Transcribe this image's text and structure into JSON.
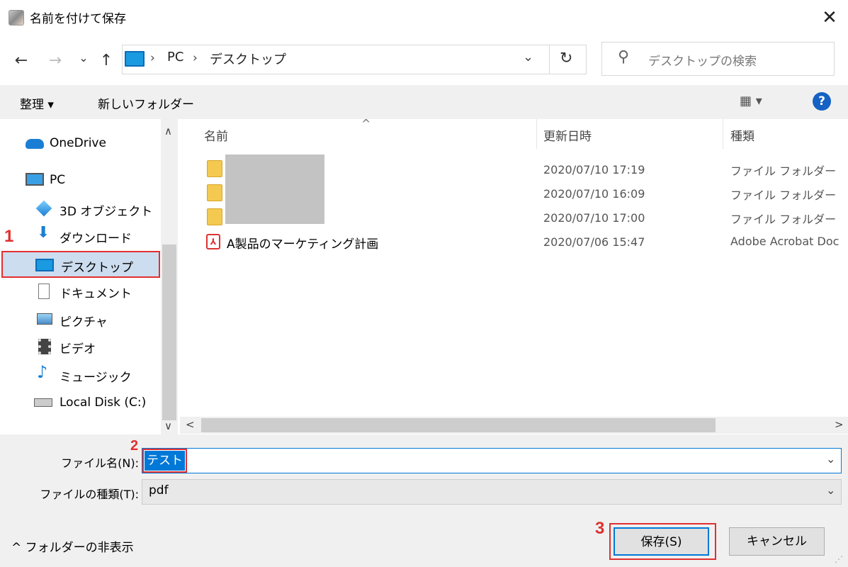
{
  "window": {
    "title": "名前を付けて保存",
    "close": "✕"
  },
  "address": {
    "back": "←",
    "forward": "→",
    "recent": "⌄",
    "up": "↑",
    "sep": "›",
    "crumbs": [
      "PC",
      "デスクトップ"
    ],
    "dropdown": "⌄",
    "refresh": "↻",
    "search_placeholder": "デスクトップの検索"
  },
  "toolbar": {
    "organize": "整理 ▾",
    "new_folder": "新しいフォルダー",
    "view": "▦ ▾",
    "help": "?"
  },
  "nav": {
    "items": [
      {
        "label": "OneDrive"
      },
      {
        "label": "PC"
      },
      {
        "label": "3D オブジェクト"
      },
      {
        "label": "ダウンロード"
      },
      {
        "label": "デスクトップ"
      },
      {
        "label": "ドキュメント"
      },
      {
        "label": "ピクチャ"
      },
      {
        "label": "ビデオ"
      },
      {
        "label": "ミュージック"
      },
      {
        "label": "Local Disk (C:)"
      }
    ],
    "scroll_up": "∧",
    "scroll_down": "∨"
  },
  "filelist": {
    "columns": [
      "名前",
      "更新日時",
      "種類"
    ],
    "sort_caret": "^",
    "rows": [
      {
        "name": "",
        "date": "2020/07/10 17:19",
        "type": "ファイル フォルダー"
      },
      {
        "name": "",
        "date": "2020/07/10 16:09",
        "type": "ファイル フォルダー"
      },
      {
        "name": "",
        "date": "2020/07/10 17:00",
        "type": "ファイル フォルダー"
      },
      {
        "name": "A製品のマーケティング計画",
        "date": "2020/07/06 15:47",
        "type": "Adobe Acrobat Doc"
      }
    ],
    "scroll_left": "<",
    "scroll_right": ">"
  },
  "form": {
    "filename_label": "ファイル名(N):",
    "filename_value": "テスト",
    "filetype_label": "ファイルの種類(T):",
    "filetype_value": "pdf",
    "combo_arrow": "⌄"
  },
  "footer": {
    "hide_folders": "^ フォルダーの非表示",
    "save": "保存(S)",
    "cancel": "キャンセル",
    "grip": "⋰"
  },
  "annotations": {
    "step1": "1",
    "step2": "2",
    "step3": "3"
  }
}
